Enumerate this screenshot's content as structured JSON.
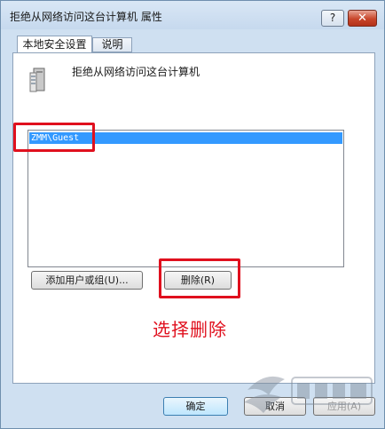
{
  "window": {
    "title": "拒绝从网络访问这台计算机 属性",
    "help_label": "?",
    "close_label": "✕"
  },
  "tabs": [
    {
      "label": "本地安全设置"
    },
    {
      "label": "说明"
    }
  ],
  "policy": {
    "icon": "server-icon",
    "name": "拒绝从网络访问这台计算机"
  },
  "list": {
    "items": [
      "ZMM\\Guest"
    ],
    "selected_index": 0
  },
  "buttons": {
    "add": "添加用户或组(U)...",
    "remove": "删除(R)",
    "ok": "确定",
    "cancel": "取消",
    "apply": "应用(A)"
  },
  "annotation": {
    "text": "选择删除",
    "color": "#e0101e"
  },
  "colors": {
    "selection": "#3399ff",
    "close_button": "#c8452a"
  }
}
